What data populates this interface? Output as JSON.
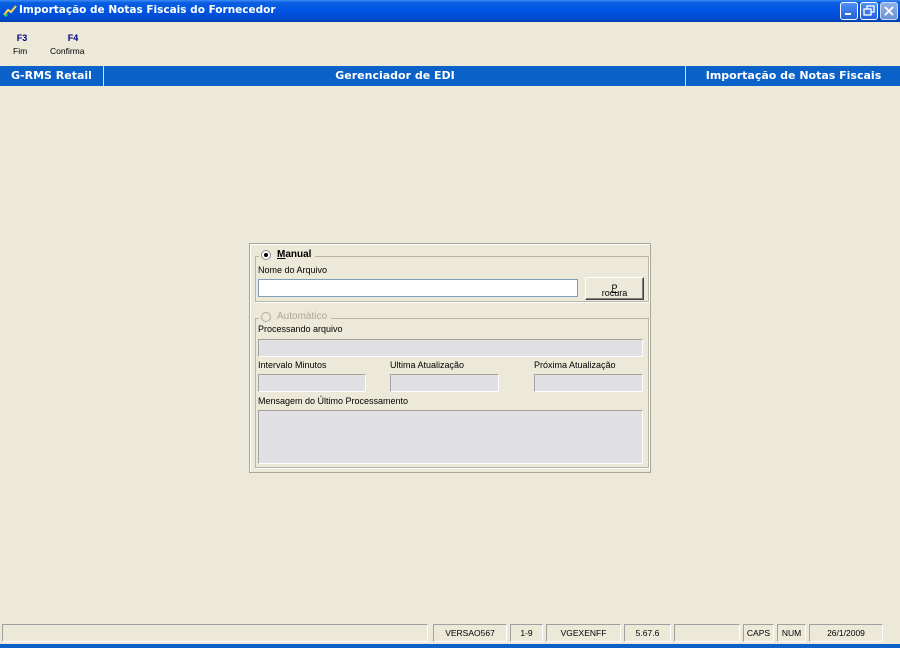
{
  "window": {
    "title": "Importação de Notas Fiscais do Fornecedor",
    "icon": "app-icon",
    "buttons": [
      "minimize-icon",
      "restore-icon",
      "close-icon"
    ]
  },
  "toolbar": {
    "keys": [
      {
        "key": "F3",
        "label": "Fim"
      },
      {
        "key": "F4",
        "label": "Confirma"
      }
    ]
  },
  "header": {
    "left": "G-RMS Retail",
    "center": "Gerenciador de EDI",
    "right": "Importação de Notas Fiscais"
  },
  "manual": {
    "option_label_underlined": "M",
    "option_label_rest": "anual",
    "selected": true,
    "file_label": "Nome do Arquivo",
    "file_value": "",
    "browse_underlined": "P",
    "browse_rest": "rocura"
  },
  "auto": {
    "option_label": "Automático",
    "selected": false,
    "processing_label": "Processando arquivo",
    "interval_label": "Intervalo Minutos",
    "last_update_label": "Ultima Atualização",
    "next_update_label": "Próxima Atualização",
    "message_label": "Mensagem do Último Processamento"
  },
  "statusbar": {
    "cells": [
      "",
      "VERSAO567",
      "1-9",
      "VGEXENFF",
      "5.67.6",
      "",
      "CAPS",
      "NUM",
      "26/1/2009"
    ]
  },
  "colors": {
    "background": "#ece9d8",
    "header_band": "#0a61c8",
    "titlebar": "#0054e3",
    "function_key": "#000080"
  }
}
